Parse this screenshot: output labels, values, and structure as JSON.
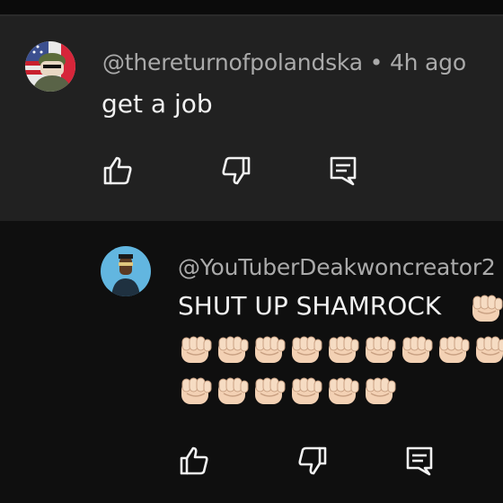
{
  "comment": {
    "author": "@thereturnofpolandska",
    "separator": "•",
    "time": "4h ago",
    "text": "get a job"
  },
  "reply": {
    "author": "@YouTuberDeakwoncreator2",
    "text": "SHUT UP SHAMROCK",
    "emoji_row1_count": 9,
    "emoji_row2_count": 6,
    "emoji": "👊🏻"
  },
  "icons": {
    "like": "thumbs-up-icon",
    "dislike": "thumbs-down-icon",
    "reply": "comment-icon"
  },
  "colors": {
    "page_bg": "#0f0f0f",
    "comment_bg": "#212121",
    "author_text": "#aaaaaa",
    "body_text": "#f1f1f1"
  }
}
